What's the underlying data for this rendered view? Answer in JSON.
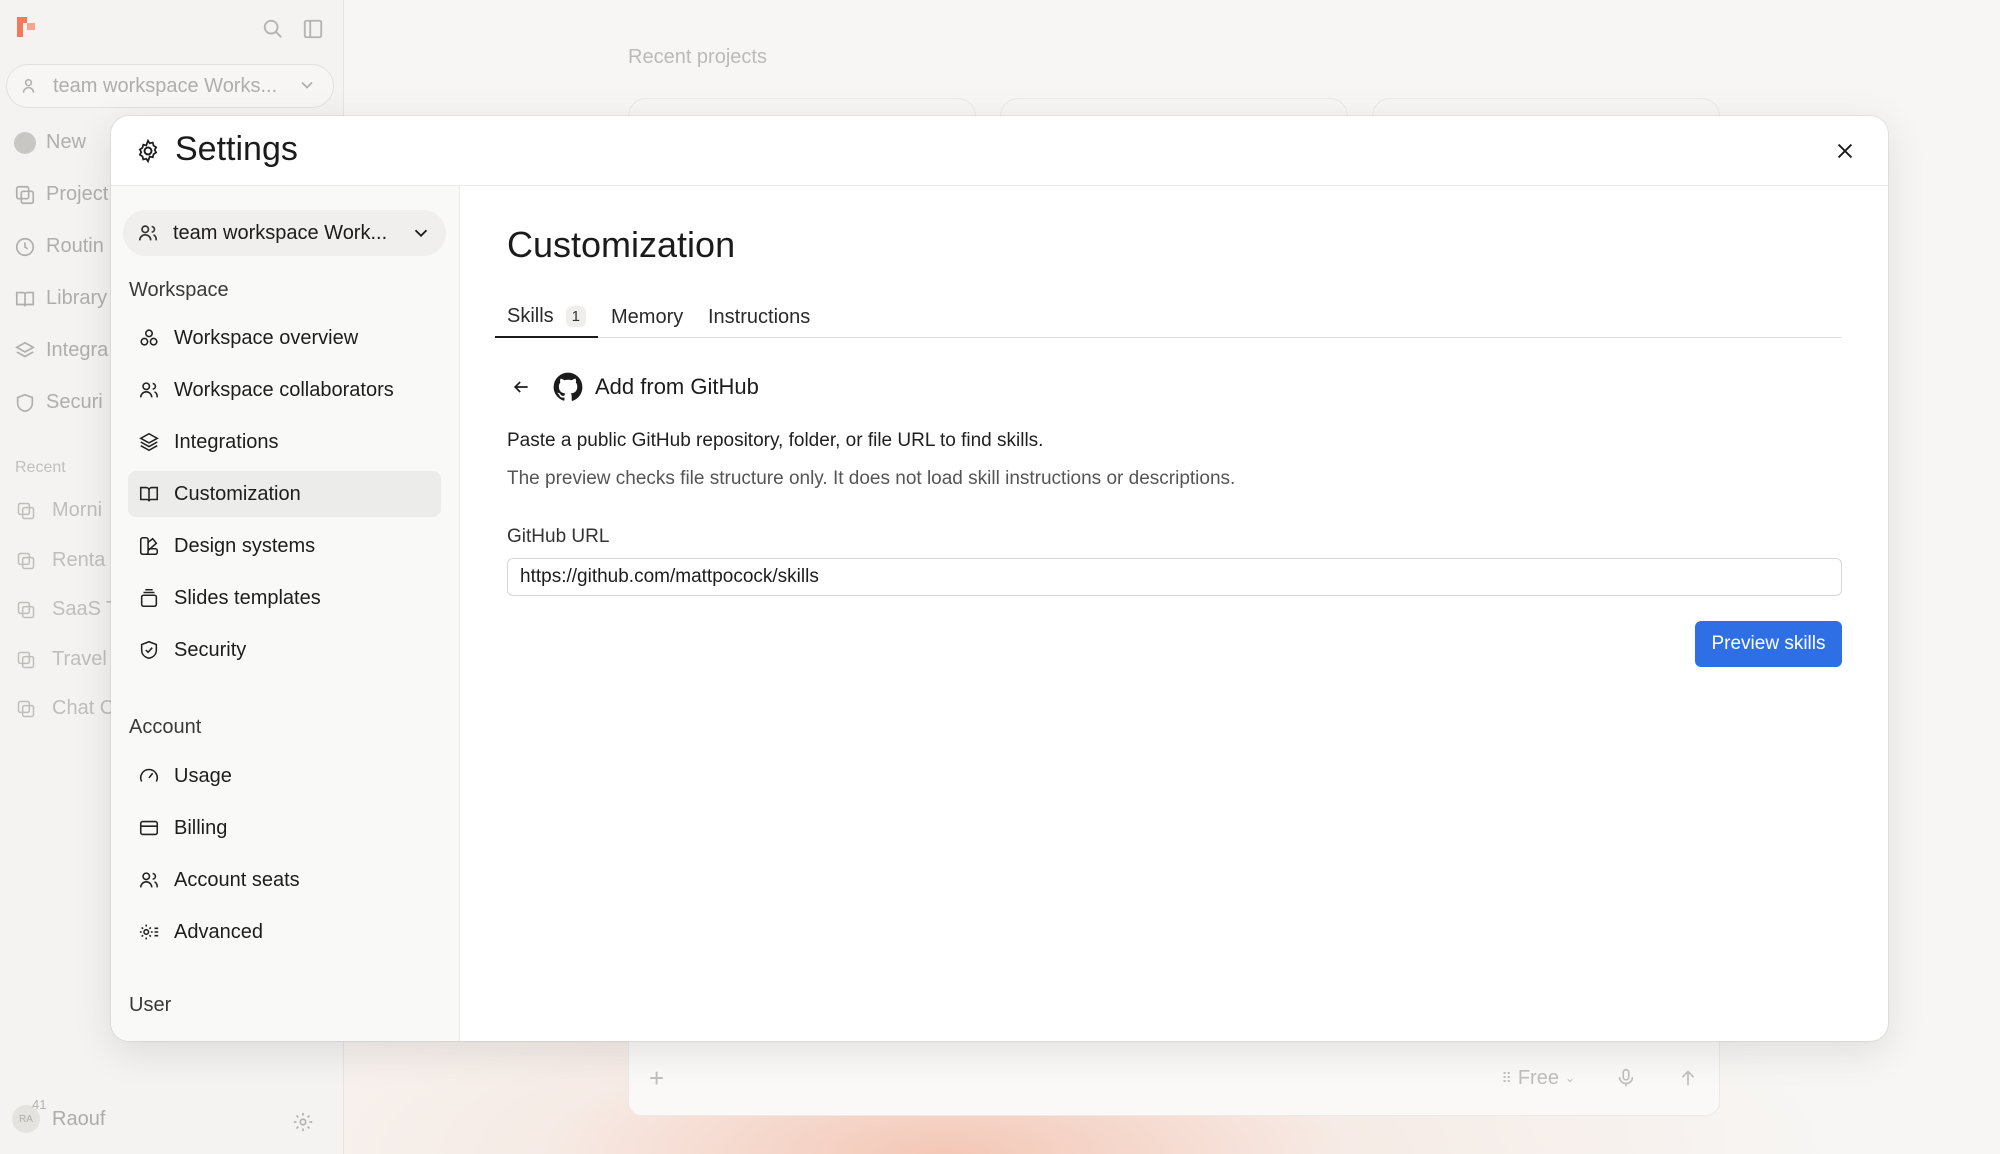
{
  "background": {
    "workspace_pill": "team workspace Works...",
    "nav": {
      "new": "New",
      "projects": "Project",
      "routines": "Routin",
      "library": "Library",
      "integrations": "Integra",
      "security": "Securi"
    },
    "recent_heading": "Recent",
    "recent_items": [
      "Morni",
      "Renta",
      "SaaS T",
      "Travel",
      "Chat C"
    ],
    "user_name": "Raouf",
    "user_initials": "RA",
    "user_count": "41",
    "recent_projects_heading": "Recent projects",
    "composer": {
      "plus": "+",
      "plan": "Free"
    }
  },
  "modal": {
    "title": "Settings",
    "workspace_select": "team workspace Work...",
    "workspace_heading": "Workspace",
    "workspace_items": {
      "overview": "Workspace overview",
      "collaborators": "Workspace collaborators",
      "integrations": "Integrations",
      "customization": "Customization",
      "design_systems": "Design systems",
      "slides_templates": "Slides templates",
      "security": "Security"
    },
    "account_heading": "Account",
    "account_items": {
      "usage": "Usage",
      "billing": "Billing",
      "seats": "Account seats",
      "advanced": "Advanced"
    },
    "user_heading": "User",
    "content": {
      "title": "Customization",
      "tabs": {
        "skills": "Skills",
        "skills_count": "1",
        "memory": "Memory",
        "instructions": "Instructions"
      },
      "back_title": "Add from GitHub",
      "desc_primary": "Paste a public GitHub repository, folder, or file URL to find skills.",
      "desc_secondary": "The preview checks file structure only. It does not load skill instructions or descriptions.",
      "url_label": "GitHub URL",
      "url_value": "https://github.com/mattpocock/skills",
      "preview_button": "Preview skills"
    }
  },
  "colors": {
    "accent": "#2f6fe5",
    "logo": "#f07a5a",
    "active_item_bg": "#ececeb"
  }
}
